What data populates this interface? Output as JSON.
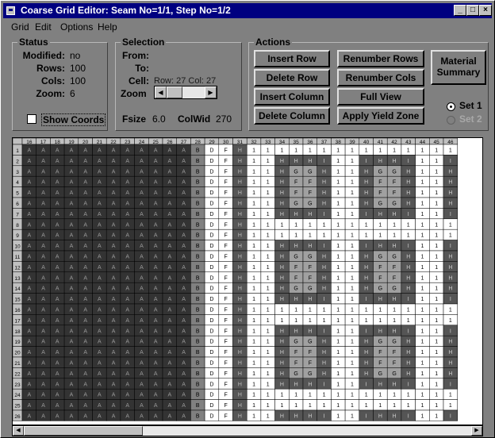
{
  "window": {
    "title": "Coarse Grid Editor: Seam No=1/1,  Step No=1/2"
  },
  "menu": [
    "Grid",
    "Edit",
    "Options",
    "Help"
  ],
  "status": {
    "title": "Status",
    "modified_label": "Modified:",
    "modified": "no",
    "rows_label": "Rows:",
    "rows": "100",
    "cols_label": "Cols:",
    "cols": "100",
    "zoom_label": "Zoom:",
    "zoom": "6",
    "show_coords": "Show Coords"
  },
  "selection": {
    "title": "Selection",
    "from_label": "From:",
    "to_label": "To:",
    "cell_label": "Cell:",
    "cell": "Row: 27 Col: 27",
    "zoom_label": "Zoom",
    "fsize_label": "Fsize",
    "fsize": "6.0",
    "colwid_label": "ColWid",
    "colwid": "270"
  },
  "actions": {
    "title": "Actions",
    "insert_row": "Insert Row",
    "delete_row": "Delete Row",
    "insert_column": "Insert Column",
    "delete_column": "Delete Column",
    "renumber_rows": "Renumber Rows",
    "renumber_cols": "Renumber Cols",
    "full_view": "Full View",
    "apply_yield_zone": "Apply Yield Zone",
    "material_summary": "Material Summary",
    "set1": "Set 1",
    "set2": "Set 2"
  },
  "grid": {
    "col_headers": [
      "16",
      "17",
      "18",
      "19",
      "20",
      "21",
      "22",
      "23",
      "24",
      "25",
      "26",
      "27",
      "28",
      "29",
      "30",
      "31",
      "32",
      "33",
      "34",
      "35",
      "36",
      "37",
      "38",
      "39",
      "40",
      "41",
      "42",
      "43",
      "44",
      "45",
      "46"
    ],
    "row_headers": [
      "1",
      "2",
      "3",
      "4",
      "5",
      "6",
      "7",
      "8",
      "9",
      "10",
      "11",
      "12",
      "13",
      "14",
      "15",
      "16",
      "17",
      "18",
      "19",
      "20",
      "21",
      "22",
      "23",
      "24",
      "25",
      "26"
    ],
    "cell_types": [
      "dark",
      "light",
      "white",
      "gray",
      "label"
    ]
  }
}
